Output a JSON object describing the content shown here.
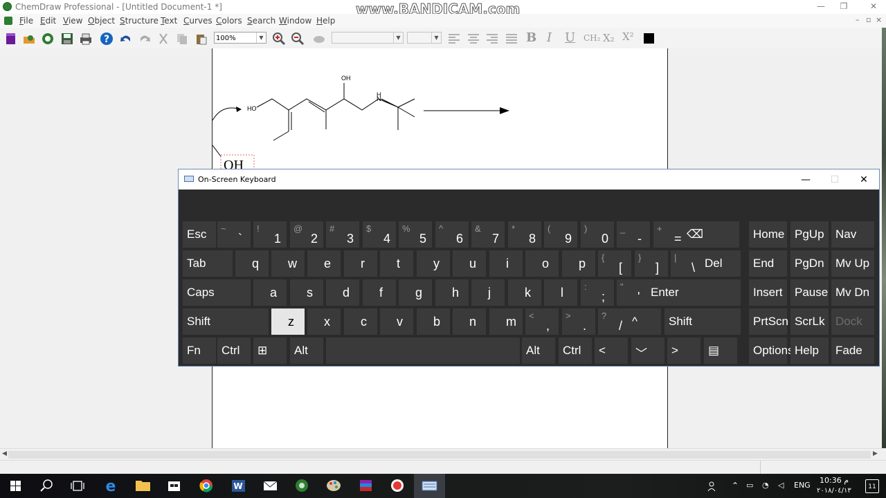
{
  "window": {
    "title": "ChemDraw Professional - [Untitled Document-1 *]",
    "watermark": "www.BANDICAM.com",
    "minimize": "—",
    "maximize": "❐",
    "close": "✕"
  },
  "menu": {
    "items": [
      "File",
      "Edit",
      "View",
      "Object",
      "Structure",
      "Text",
      "Curves",
      "Colors",
      "Search",
      "Window",
      "Help"
    ],
    "mdi_min": "–",
    "mdi_restore": "▫",
    "mdi_close": "×"
  },
  "toolbar": {
    "zoom": "100%",
    "bold": "B",
    "italic": "I",
    "underline": "U",
    "formula": "CH₂",
    "subscript": "X₂",
    "superscript": "X²",
    "color": "#000000"
  },
  "canvas": {
    "labels": {
      "ho": "HO",
      "oh_top": "OH",
      "nh_n": "N",
      "nh_h": "H",
      "oh_big": "OH"
    }
  },
  "osk": {
    "title": "On-Screen Keyboard",
    "rows": {
      "r1": [
        {
          "main": "Esc"
        },
        {
          "shift": "~",
          "main": "`"
        },
        {
          "shift": "!",
          "main": "1"
        },
        {
          "shift": "@",
          "main": "2"
        },
        {
          "shift": "#",
          "main": "3"
        },
        {
          "shift": "$",
          "main": "4"
        },
        {
          "shift": "%",
          "main": "5"
        },
        {
          "shift": "^",
          "main": "6"
        },
        {
          "shift": "&",
          "main": "7"
        },
        {
          "shift": "*",
          "main": "8"
        },
        {
          "shift": "(",
          "main": "9"
        },
        {
          "shift": ")",
          "main": "0"
        },
        {
          "shift": "_",
          "main": "-"
        },
        {
          "shift": "+",
          "main": "="
        },
        {
          "main": "⌫"
        },
        {
          "main": "Home"
        },
        {
          "main": "PgUp"
        },
        {
          "main": "Nav"
        }
      ],
      "r2": [
        {
          "main": "Tab"
        },
        {
          "main": "q"
        },
        {
          "main": "w"
        },
        {
          "main": "e"
        },
        {
          "main": "r"
        },
        {
          "main": "t"
        },
        {
          "main": "y"
        },
        {
          "main": "u"
        },
        {
          "main": "i"
        },
        {
          "main": "o"
        },
        {
          "main": "p"
        },
        {
          "shift": "{",
          "main": "["
        },
        {
          "shift": "}",
          "main": "]"
        },
        {
          "shift": "|",
          "main": "\\"
        },
        {
          "main": "Del"
        },
        {
          "main": "End"
        },
        {
          "main": "PgDn"
        },
        {
          "main": "Mv Up"
        }
      ],
      "r3": [
        {
          "main": "Caps"
        },
        {
          "main": "a"
        },
        {
          "main": "s"
        },
        {
          "main": "d"
        },
        {
          "main": "f"
        },
        {
          "main": "g"
        },
        {
          "main": "h"
        },
        {
          "main": "j"
        },
        {
          "main": "k"
        },
        {
          "main": "l"
        },
        {
          "shift": ":",
          "main": ";"
        },
        {
          "shift": "\"",
          "main": "'"
        },
        {
          "main": "Enter"
        },
        {
          "main": "Insert"
        },
        {
          "main": "Pause"
        },
        {
          "main": "Mv Dn"
        }
      ],
      "r4": [
        {
          "main": "Shift"
        },
        {
          "main": "z"
        },
        {
          "main": "x"
        },
        {
          "main": "c"
        },
        {
          "main": "v"
        },
        {
          "main": "b"
        },
        {
          "main": "n"
        },
        {
          "main": "m"
        },
        {
          "shift": "<",
          "main": ","
        },
        {
          "shift": ">",
          "main": "."
        },
        {
          "shift": "?",
          "main": "/"
        },
        {
          "main": "^"
        },
        {
          "main": "Shift"
        },
        {
          "main": "PrtScn"
        },
        {
          "main": "ScrLk"
        },
        {
          "main": "Dock"
        }
      ],
      "r5": [
        {
          "main": "Fn"
        },
        {
          "main": "Ctrl"
        },
        {
          "main": "⊞"
        },
        {
          "main": "Alt"
        },
        {
          "main": ""
        },
        {
          "main": "Alt"
        },
        {
          "main": "Ctrl"
        },
        {
          "main": "<"
        },
        {
          "main": "﹀"
        },
        {
          "main": ">"
        },
        {
          "main": "▤"
        },
        {
          "main": "Options"
        },
        {
          "main": "Help"
        },
        {
          "main": "Fade"
        }
      ]
    }
  },
  "taskbar": {
    "lang": "ENG",
    "time": "10:36 م",
    "date": "٢٠١٨/٠٤/١٣",
    "notif_count": "11"
  }
}
